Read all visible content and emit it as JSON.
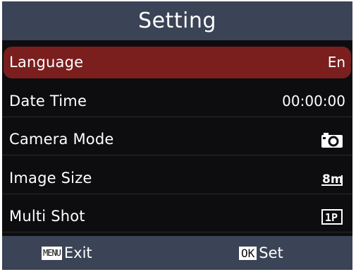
{
  "header": {
    "title": "Setting"
  },
  "menu": {
    "items": [
      {
        "label": "Language",
        "value": "En",
        "selected": true
      },
      {
        "label": "Date Time",
        "value": "00:00:00",
        "selected": false
      },
      {
        "label": "Camera Mode",
        "value": "",
        "icon": "camera-icon",
        "selected": false
      },
      {
        "label": "Image Size",
        "value": "8m",
        "icon": "image-size-8m-icon",
        "selected": false
      },
      {
        "label": "Multi Shot",
        "value": "1P",
        "icon": "multi-shot-1p-icon",
        "selected": false
      }
    ]
  },
  "footer": {
    "left_key": "MENU",
    "left_label": "Exit",
    "right_key": "OK",
    "right_label": "Set"
  },
  "colors": {
    "header_bg": "#3b4356",
    "screen_bg": "#0d0d0f",
    "selected_bg": "#7a1e1e",
    "text": "#ffffff"
  }
}
